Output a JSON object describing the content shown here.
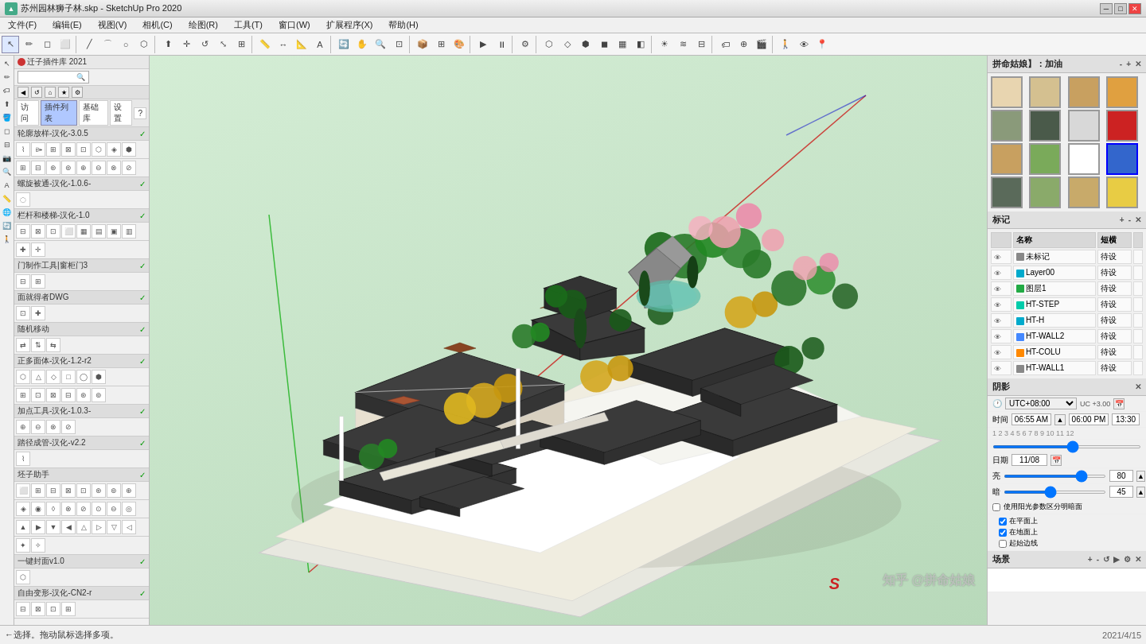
{
  "titlebar": {
    "icon": "SU",
    "title": "苏州园林狮子林.skp - SketchUp Pro 2020",
    "minimize": "─",
    "maximize": "□",
    "close": "✕"
  },
  "menubar": {
    "items": [
      "文件(F)",
      "编辑(E)",
      "视图(V)",
      "相机(C)",
      "绘图(R)",
      "工具(T)",
      "窗口(W)",
      "扩展程序(X)",
      "帮助(H)"
    ]
  },
  "plugin_panel": {
    "header": "迁子插件库 2021",
    "search_placeholder": "",
    "tabs": [
      "访问",
      "插件列表",
      "基础库",
      "设置"
    ],
    "sections": [
      {
        "name": "轮廓放样-汉化-3.0.5",
        "enabled": true
      },
      {
        "name": "螺旋被通-汉化-1.0.6-",
        "enabled": true
      },
      {
        "name": "栏杆和楼梯-汉化-1.0",
        "enabled": true
      },
      {
        "name": "门制作工具|窗柜门3",
        "enabled": true
      },
      {
        "name": "面就得者DWG",
        "enabled": true
      },
      {
        "name": "随机移动",
        "enabled": true
      },
      {
        "name": "正多面体-汉化-1.2-r2",
        "enabled": true
      },
      {
        "name": "加点工具-汉化-1.0.3-",
        "enabled": true
      },
      {
        "name": "踏径成管-汉化-v2.2",
        "enabled": true
      },
      {
        "name": "坯子助手",
        "enabled": true
      },
      {
        "name": "一键封面v1.0",
        "enabled": true
      },
      {
        "name": "自由变形-汉化-CN2-r",
        "enabled": true
      }
    ]
  },
  "right_panel": {
    "style_section": {
      "title": "拼命姑娘】：加油",
      "tiles": [
        {
          "bg": "#e8d5b0",
          "col": 0,
          "row": 0
        },
        {
          "bg": "#d4c090",
          "col": 1,
          "row": 0
        },
        {
          "bg": "#c8a060",
          "col": 2,
          "row": 0
        },
        {
          "bg": "#e0a040",
          "col": 3,
          "row": 0,
          "selected": true
        },
        {
          "bg": "#8a9a7a",
          "col": 0,
          "row": 1
        },
        {
          "bg": "#4a5a4a",
          "col": 1,
          "row": 1
        },
        {
          "bg": "#d8d8d8",
          "col": 2,
          "row": 1
        },
        {
          "bg": "#cc2222",
          "col": 3,
          "row": 1
        },
        {
          "bg": "#c8a060",
          "col": 0,
          "row": 2
        },
        {
          "bg": "#7aaa5a",
          "col": 1,
          "row": 2
        },
        {
          "bg": "#ffffff",
          "col": 2,
          "row": 2
        },
        {
          "bg": "#3366cc",
          "col": 3,
          "row": 2,
          "selected": true
        },
        {
          "bg": "#5a6a5a",
          "col": 0,
          "row": 3
        },
        {
          "bg": "#8aaa6a",
          "col": 1,
          "row": 3
        },
        {
          "bg": "#c8aa6a",
          "col": 2,
          "row": 3
        },
        {
          "bg": "#e8cc44",
          "col": 3,
          "row": 3
        }
      ]
    },
    "markers_section": {
      "title": "标记",
      "columns": [
        "名称",
        "短横"
      ],
      "rows": [
        {
          "visible": true,
          "color": "#888888",
          "name": "未标记",
          "tag": "待设"
        },
        {
          "visible": true,
          "color": "#00aacc",
          "name": "Layer00",
          "tag": "待设"
        },
        {
          "visible": true,
          "color": "#22aa44",
          "name": "图层1",
          "tag": "待设"
        },
        {
          "visible": true,
          "color": "#00ccaa",
          "name": "HT-STEP",
          "tag": "待设"
        },
        {
          "visible": true,
          "color": "#00aacc",
          "name": "HT-H",
          "tag": "待设"
        },
        {
          "visible": true,
          "color": "#4488ff",
          "name": "HT-WALL2",
          "tag": "待设"
        },
        {
          "visible": true,
          "color": "#ff8800",
          "name": "HT-COLU",
          "tag": "待设"
        },
        {
          "visible": true,
          "color": "#888888",
          "name": "HT-WALL1",
          "tag": "待设"
        }
      ]
    },
    "shadow_section": {
      "title": "阴影",
      "utc_label": "UTC",
      "utc_value": "UTC+08:00",
      "time_label": "时间",
      "time_start": "06:55 AM",
      "time_end": "06:00 PM",
      "time_current": "13:30",
      "date_label": "日期",
      "date_value": "11/08",
      "bright_label": "亮",
      "bright_value": "80",
      "dark_label": "暗",
      "dark_value": "45",
      "checkbox_label": "使用阳光参数区分明暗面",
      "sub_checks": [
        "在平面上",
        "在地面上",
        "起始边线"
      ]
    },
    "scene_section": {
      "title": "场景"
    }
  },
  "status_bar": {
    "message": "←选择。拖动鼠标选择多项。"
  },
  "watermark": "知乎 @拼命姑娘",
  "shadow_utc_plus": "UC +3.00"
}
